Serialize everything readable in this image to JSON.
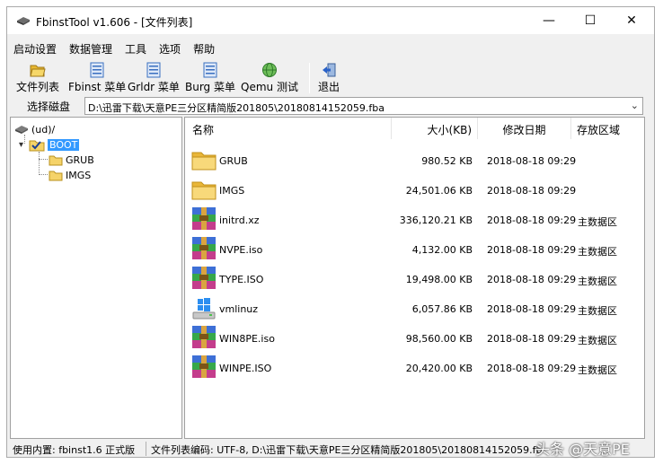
{
  "window": {
    "title": "FbinstTool v1.606 - [文件列表]",
    "controls": {
      "minimize": "—",
      "maximize": "☐",
      "close": "✕"
    }
  },
  "menubar": [
    "启动设置",
    "数据管理",
    "工具",
    "选项",
    "帮助"
  ],
  "toolbar": [
    {
      "label": "文件列表",
      "icon": "folder-open-icon"
    },
    {
      "label": "Fbinst 菜单",
      "icon": "menu-list-icon"
    },
    {
      "label": "Grldr 菜单",
      "icon": "menu-list-icon"
    },
    {
      "label": "Burg 菜单",
      "icon": "menu-list-icon"
    },
    {
      "label": "Qemu 测试",
      "icon": "globe-icon"
    },
    {
      "label": "退出",
      "icon": "exit-icon"
    }
  ],
  "disk": {
    "label": "选择磁盘",
    "value": "D:\\迅雷下载\\天意PE三分区精简版201805\\20180814152059.fba"
  },
  "tree": [
    {
      "label": "(ud)/",
      "icon": "drive-icon",
      "level": 0,
      "expander": ""
    },
    {
      "label": "BOOT",
      "icon": "folder-check-icon",
      "level": 1,
      "expander": "▾",
      "selected": true
    },
    {
      "label": "GRUB",
      "icon": "folder-icon",
      "level": 2,
      "expander": ""
    },
    {
      "label": "IMGS",
      "icon": "folder-icon",
      "level": 2,
      "expander": ""
    }
  ],
  "columns": {
    "name": "名称",
    "size": "大小(KB)",
    "date": "修改日期",
    "area": "存放区域"
  },
  "files": [
    {
      "name": "GRUB",
      "size": "980.52 KB",
      "date": "2018-08-18 09:29",
      "area": "",
      "icon": "folder-icon"
    },
    {
      "name": "IMGS",
      "size": "24,501.06 KB",
      "date": "2018-08-18 09:29",
      "area": "",
      "icon": "folder-icon"
    },
    {
      "name": "initrd.xz",
      "size": "336,120.21 KB",
      "date": "2018-08-18 09:29",
      "area": "主数据区",
      "icon": "archive-icon"
    },
    {
      "name": "NVPE.iso",
      "size": "4,132.00 KB",
      "date": "2018-08-18 09:29",
      "area": "主数据区",
      "icon": "archive-icon"
    },
    {
      "name": "TYPE.ISO",
      "size": "19,498.00 KB",
      "date": "2018-08-18 09:29",
      "area": "主数据区",
      "icon": "archive-icon"
    },
    {
      "name": "vmlinuz",
      "size": "6,057.86 KB",
      "date": "2018-08-18 09:29",
      "area": "主数据区",
      "icon": "windows-drive-icon"
    },
    {
      "name": "WIN8PE.iso",
      "size": "98,560.00 KB",
      "date": "2018-08-18 09:29",
      "area": "主数据区",
      "icon": "archive-icon"
    },
    {
      "name": "WINPE.ISO",
      "size": "20,420.00 KB",
      "date": "2018-08-18 09:29",
      "area": "主数据区",
      "icon": "archive-icon"
    }
  ],
  "status": {
    "left": "使用内置: fbinst1.6 正式版",
    "right": "文件列表编码: UTF-8, D:\\迅雷下载\\天意PE三分区精简版201805\\20180814152059.fba"
  },
  "watermark": "头条 @天意PE"
}
